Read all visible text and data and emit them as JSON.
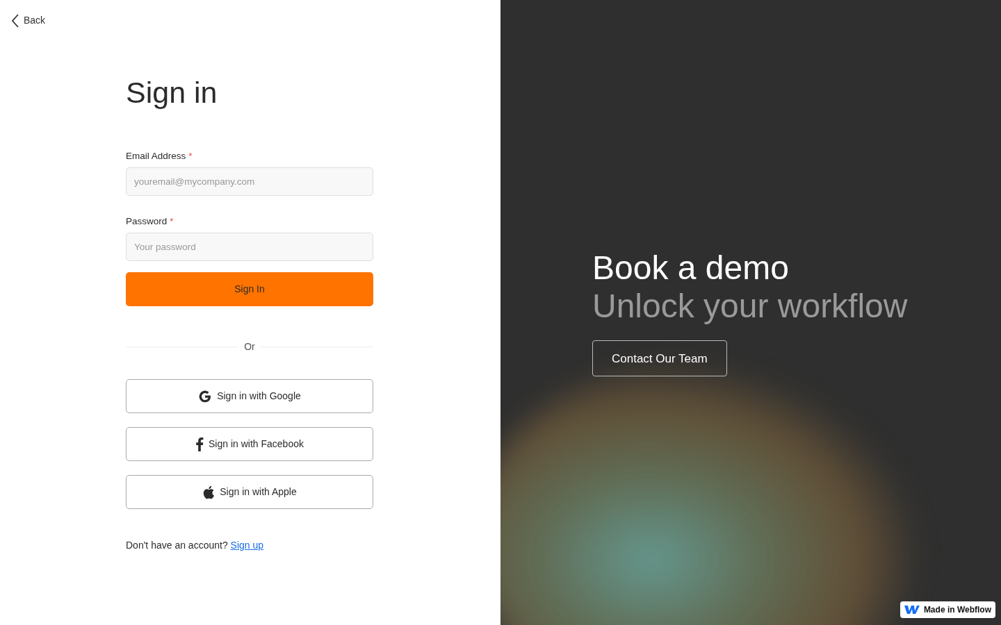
{
  "back_link": {
    "label": "Back"
  },
  "title": "Sign in",
  "fields": [
    {
      "label": "Email Address",
      "required_mark": "*",
      "placeholder": "youremail@mycompany.com"
    },
    {
      "label": "Password",
      "required_mark": "*",
      "placeholder": "Your password"
    }
  ],
  "submit_button": "Sign In",
  "divider_text": "Or",
  "social_buttons": [
    {
      "kind": "google",
      "label": "Sign in with Google"
    },
    {
      "kind": "facebook",
      "label": "Sign in with Facebook"
    },
    {
      "kind": "apple",
      "label": "Sign in with Apple"
    }
  ],
  "signup_prompt": {
    "text": "Don't have an account?",
    "link": "Sign up"
  },
  "promo": {
    "headline": "Book a demo",
    "subheadline": "Unlock your workflow",
    "button": "Contact Our Team"
  },
  "badge": {
    "label": "Made in Webflow"
  }
}
